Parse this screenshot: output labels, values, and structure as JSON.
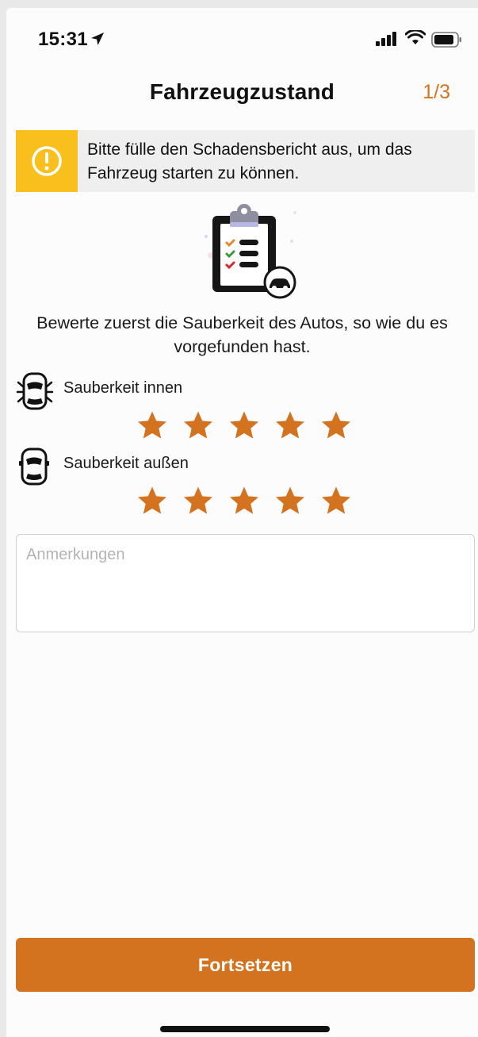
{
  "status_bar": {
    "time": "15:31",
    "icons": [
      "location-arrow-icon",
      "cellular-signal-icon",
      "wifi-icon",
      "battery-icon"
    ]
  },
  "header": {
    "title": "Fahrzeugzustand",
    "step": "1/3"
  },
  "banner": {
    "icon": "exclamation-circle-icon",
    "text": "Bitte fülle den Schadensbericht aus, um das Fahrzeug starten zu können."
  },
  "illustration": {
    "icon": "clipboard-checklist-car-icon"
  },
  "intro": "Bewerte zuerst die Sauberkeit des Autos, so wie du es vorgefunden hast.",
  "ratings": [
    {
      "label": "Sauberkeit innen",
      "icon": "car-interior-icon",
      "stars_total": 5,
      "stars_filled": 5
    },
    {
      "label": "Sauberkeit außen",
      "icon": "car-exterior-icon",
      "stars_total": 5,
      "stars_filled": 5
    }
  ],
  "notes": {
    "placeholder": "Anmerkungen",
    "value": ""
  },
  "continue_button": {
    "label": "Fortsetzen"
  },
  "colors": {
    "accent": "#d4731f",
    "warning": "#f9bf1d",
    "banner_bg": "#efefef"
  }
}
